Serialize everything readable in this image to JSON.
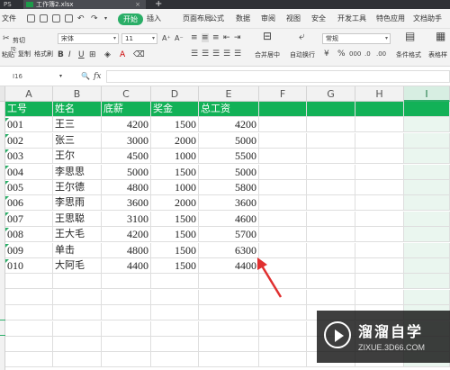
{
  "titlebar": {
    "app_label": "PS",
    "file_tab": "工作簿2.xlsx",
    "close_glyph": "×",
    "new_tab": "+"
  },
  "menubar": {
    "file_menu": "文件",
    "items": [
      "开始",
      "插入",
      "页面布局",
      "公式",
      "数据",
      "审阅",
      "视图",
      "安全",
      "开发工具",
      "特色应用",
      "文档助手"
    ],
    "active_index": 0
  },
  "toolbar": {
    "cut": "剪切",
    "paste": "粘贴",
    "copy": "复制",
    "format_painter": "格式刷",
    "font_name": "宋体",
    "font_size": "11",
    "merge_center": "合并居中",
    "wrap_text": "自动换行",
    "number_format": "常规",
    "conditional_format": "条件格式",
    "table_style": "表格样"
  },
  "formulabar": {
    "cell_ref": "I16",
    "fx": "fx",
    "zoom_glyph": "🔍",
    "formula": ""
  },
  "sheet": {
    "columns": [
      "A",
      "B",
      "C",
      "D",
      "E",
      "F",
      "G",
      "H",
      "I"
    ],
    "selected_column": "I",
    "headers": [
      "工号",
      "姓名",
      "底薪",
      "奖金",
      "总工资"
    ],
    "rows": [
      [
        "001",
        "王三",
        "4200",
        "1500",
        "4200"
      ],
      [
        "002",
        "张三",
        "3000",
        "2000",
        "5000"
      ],
      [
        "003",
        "王尔",
        "4500",
        "1000",
        "5500"
      ],
      [
        "004",
        "李思思",
        "5000",
        "1500",
        "5000"
      ],
      [
        "005",
        "王尔德",
        "4800",
        "1000",
        "5800"
      ],
      [
        "006",
        "李思雨",
        "3600",
        "2000",
        "3600"
      ],
      [
        "007",
        "王思聪",
        "3100",
        "1500",
        "4600"
      ],
      [
        "008",
        "王大毛",
        "4200",
        "1500",
        "5700"
      ],
      [
        "009",
        "单击",
        "4800",
        "1500",
        "6300"
      ],
      [
        "010",
        "大阿毛",
        "4400",
        "1500",
        "4400"
      ]
    ],
    "accent_color": "#12b157"
  },
  "watermark": {
    "brand": "溜溜自学",
    "site": "ZIXUE.3D66.COM"
  },
  "colors": {
    "arrow": "#e03030",
    "header_fill": "#12b157",
    "active_tab": "#2aae67"
  }
}
